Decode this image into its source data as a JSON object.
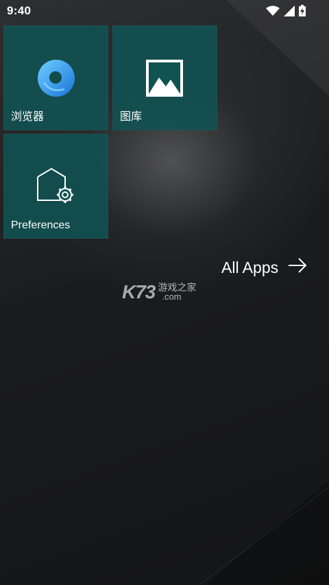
{
  "status_bar": {
    "time": "9:40",
    "icons": [
      "wifi-icon",
      "cellular-signal-icon",
      "battery-charging-icon"
    ]
  },
  "tiles": [
    {
      "label": "浏览器",
      "icon": "browser-icon"
    },
    {
      "label": "图库",
      "icon": "gallery-icon"
    },
    {
      "label": "Preferences",
      "icon": "preferences-icon"
    }
  ],
  "all_apps": {
    "label": "All Apps",
    "icon": "arrow-right-icon"
  },
  "watermark": {
    "brand": "K73",
    "tagline": "游戏之家",
    "domain": ".com"
  },
  "colors": {
    "tile": "#115252",
    "browser_ring": "#2d8fe6"
  }
}
